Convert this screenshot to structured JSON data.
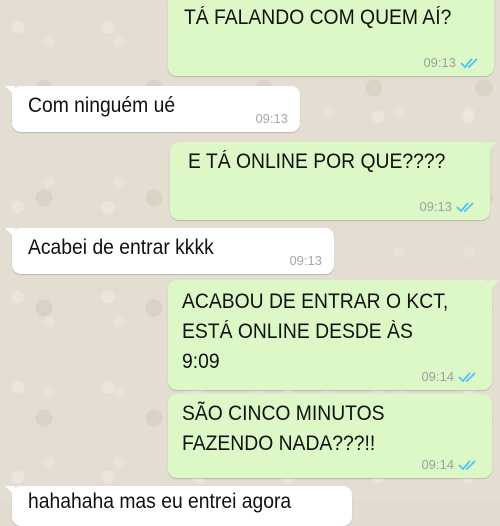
{
  "messages": [
    {
      "text": "TÁ FALANDO COM QUEM AÍ?",
      "time": "09:13"
    },
    {
      "text": "Com ninguém ué",
      "time": "09:13"
    },
    {
      "text": "E TÁ ONLINE POR QUE????",
      "time": "09:13"
    },
    {
      "text": "Acabei de entrar kkkk",
      "time": "09:13"
    },
    {
      "line1": "ACABOU DE ENTRAR O KCT,",
      "line2": "ESTÁ ONLINE DESDE ÀS",
      "line3": "9:09",
      "time": "09:14"
    },
    {
      "line1": "SÃO CINCO MINUTOS",
      "line2": "FAZENDO NADA???!!",
      "time": "09:14"
    },
    {
      "text": "hahahaha mas eu entrei agora"
    }
  ],
  "colors": {
    "outgoing": "#dcf8c6",
    "incoming": "#ffffff",
    "read_ticks": "#4fc3f7"
  },
  "icons": {
    "read_receipt": "double-check-icon"
  }
}
